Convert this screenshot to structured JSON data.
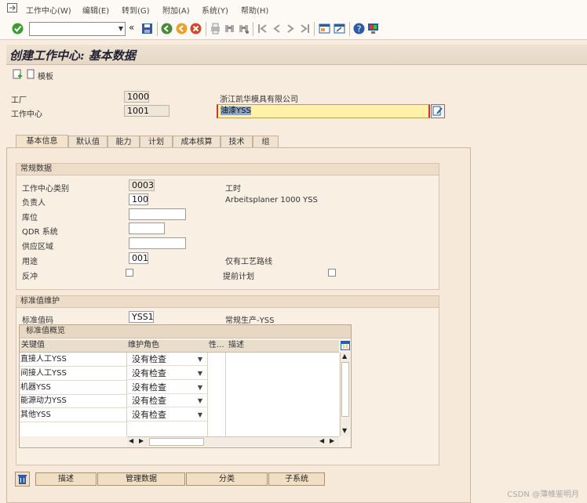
{
  "menu": {
    "items": [
      "工作中心(W)",
      "编辑(E)",
      "转到(G)",
      "附加(A)",
      "系统(Y)",
      "帮助(H)"
    ]
  },
  "toolbar": {
    "command_value": "",
    "back_chevron": "«"
  },
  "page": {
    "title": "创建工作中心: 基本数据",
    "template_label": "模板"
  },
  "header": {
    "plant_label": "工厂",
    "plant_value": "1000",
    "plant_desc": "浙江凯华模具有限公司",
    "wc_label": "工作中心",
    "wc_value": "1001",
    "wc_desc": "油漆YSS"
  },
  "tabs": [
    {
      "label": "基本信息",
      "active": true
    },
    {
      "label": "默认值",
      "active": false
    },
    {
      "label": "能力",
      "active": false
    },
    {
      "label": "计划",
      "active": false
    },
    {
      "label": "成本核算",
      "active": false
    },
    {
      "label": "技术",
      "active": false
    },
    {
      "label": "组",
      "active": false
    }
  ],
  "general": {
    "title": "常规数据",
    "category_label": "工作中心类别",
    "category_value": "0003",
    "category_desc": "工时",
    "person_label": "负责人",
    "person_value": "100",
    "person_desc": "Arbeitsplaner  1000  YSS",
    "location_label": "库位",
    "location_value": "",
    "qdr_label": "QDR 系统",
    "qdr_value": "",
    "supply_label": "供应区域",
    "supply_value": "",
    "usage_label": "用途",
    "usage_value": "001",
    "usage_desc": "仅有工艺路线",
    "backflush_label": "反冲",
    "advance_plan_label": "提前计划"
  },
  "std": {
    "title": "标准值维护",
    "key_label": "标准值码",
    "key_value": "YSS1",
    "key_desc": "常规生产-YSS",
    "overview_title": "标准值概览",
    "col_key": "关键值",
    "col_role": "维护角色",
    "col_attr": "性...",
    "col_desc": "描述",
    "rows": [
      {
        "key": "直接人工YSS",
        "role": "没有检查"
      },
      {
        "key": "间接人工YSS",
        "role": "没有检查"
      },
      {
        "key": "机器YSS",
        "role": "没有检查"
      },
      {
        "key": "能源动力YSS",
        "role": "没有检查"
      },
      {
        "key": "其他YSS",
        "role": "没有检查"
      }
    ]
  },
  "bottom_buttons": [
    "描述",
    "管理数据",
    "分类",
    "子系统"
  ],
  "watermark": "CSDN @薄帷鉴明月",
  "colors": {
    "accent": "#f3e3cb",
    "highlight_field": "#fdf2a6",
    "background": "#f7ecde"
  },
  "icons": [
    "menu-icon",
    "check-icon",
    "save-icon",
    "back-icon",
    "exit-icon",
    "cancel-icon",
    "print-icon",
    "find-icon",
    "find-next-icon",
    "first-page-icon",
    "prev-page-icon",
    "next-page-icon",
    "last-page-icon",
    "new-session-icon",
    "shortcut-icon",
    "help-icon",
    "layout-icon",
    "create-doc-icon",
    "delete-icon",
    "table-settings-icon"
  ]
}
